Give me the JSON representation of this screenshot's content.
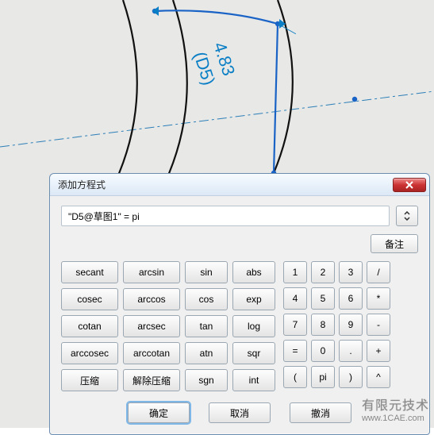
{
  "canvas": {
    "dimension_value": "4.83",
    "dimension_ref": "(D5)"
  },
  "dialog": {
    "title": "添加方程式",
    "input_value": "\"D5@草图1\" = pi",
    "note_button": "备注",
    "functions": {
      "r0": [
        "secant",
        "arcsin",
        "sin",
        "abs"
      ],
      "r1": [
        "cosec",
        "arccos",
        "cos",
        "exp"
      ],
      "r2": [
        "cotan",
        "arcsec",
        "tan",
        "log"
      ],
      "r3": [
        "arccosec",
        "arccotan",
        "atn",
        "sqr"
      ],
      "r4": [
        "压缩",
        "解除压缩",
        "sgn",
        "int"
      ]
    },
    "numpad": {
      "r0": [
        "1",
        "2",
        "3",
        "/"
      ],
      "r1": [
        "4",
        "5",
        "6",
        "*"
      ],
      "r2": [
        "7",
        "8",
        "9",
        "-"
      ],
      "r3": [
        "=",
        "0",
        ".",
        "+"
      ],
      "r4": [
        "(",
        "pi",
        ")",
        "^"
      ]
    },
    "ok": "确定",
    "cancel": "取消",
    "undo": "撤消"
  },
  "watermark": {
    "line1": "有限元技术",
    "line2": "www.1CAE.com"
  }
}
